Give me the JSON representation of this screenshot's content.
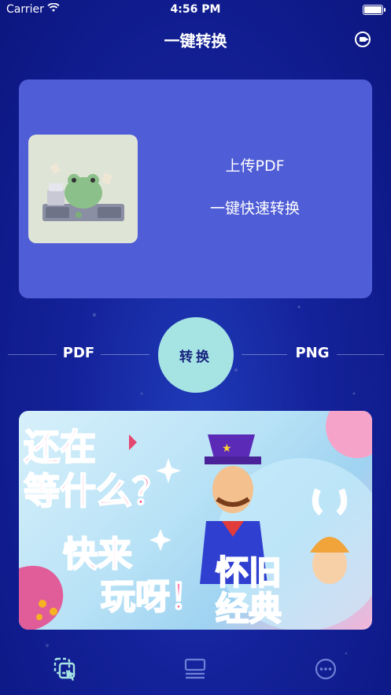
{
  "status_bar": {
    "carrier": "Carrier",
    "time": "4:56 PM"
  },
  "nav": {
    "title": "一键转换",
    "action_icon": "record-icon"
  },
  "upload_card": {
    "upload_label": "上传PDF",
    "quick_label": "一键快速转换"
  },
  "conversion": {
    "from": "PDF",
    "to": "PNG",
    "button_label": "转换"
  },
  "banner": {
    "line1": "还在",
    "line2": "等什么？",
    "line3": "快来",
    "line4": "玩呀！",
    "line5": "怀旧",
    "line6": "经典"
  },
  "tabs": [
    {
      "icon": "convert-icon",
      "active": true
    },
    {
      "icon": "screen-icon",
      "active": false
    },
    {
      "icon": "more-icon",
      "active": false
    }
  ],
  "colors": {
    "accent": "#a6e3e3",
    "card": "#4f5dd6",
    "background": "#14229a"
  }
}
